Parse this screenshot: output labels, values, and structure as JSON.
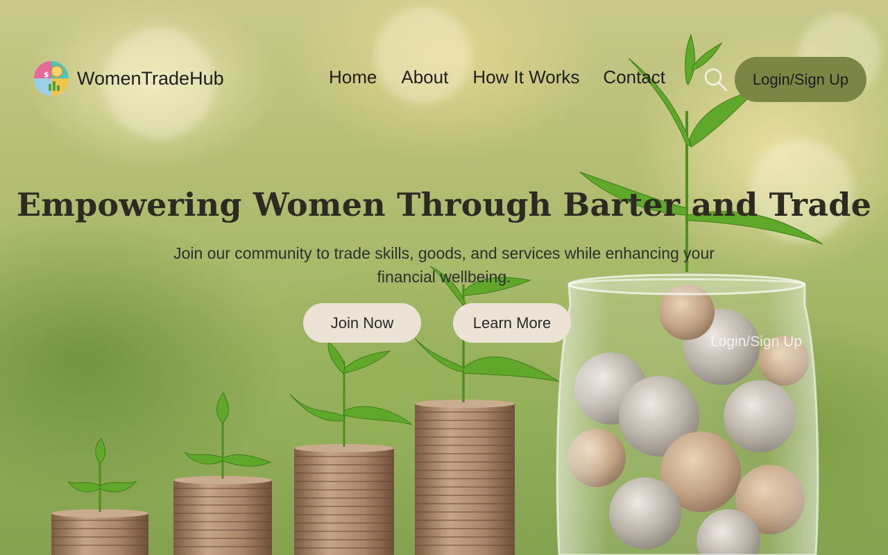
{
  "brand": {
    "name": "WomenTradeHub",
    "logo_icon": "finance-chart-logo-icon"
  },
  "nav": {
    "items": [
      {
        "label": "Home"
      },
      {
        "label": "About"
      },
      {
        "label": "How It Works"
      },
      {
        "label": "Contact"
      }
    ],
    "search_icon": "search-icon",
    "login_label": "Login/Sign Up"
  },
  "hero": {
    "title": "Empowering Women Through Barter and Trade",
    "subtitle": "Join our community to trade skills, goods, and services while enhancing your financial wellbeing.",
    "join_label": "Join Now",
    "learn_label": "Learn More",
    "overlay_login_label": "Login/Sign Up"
  },
  "colors": {
    "login_button": "#7b8544",
    "cta_button": "#ece2d6",
    "title_text": "#2d2a24"
  }
}
